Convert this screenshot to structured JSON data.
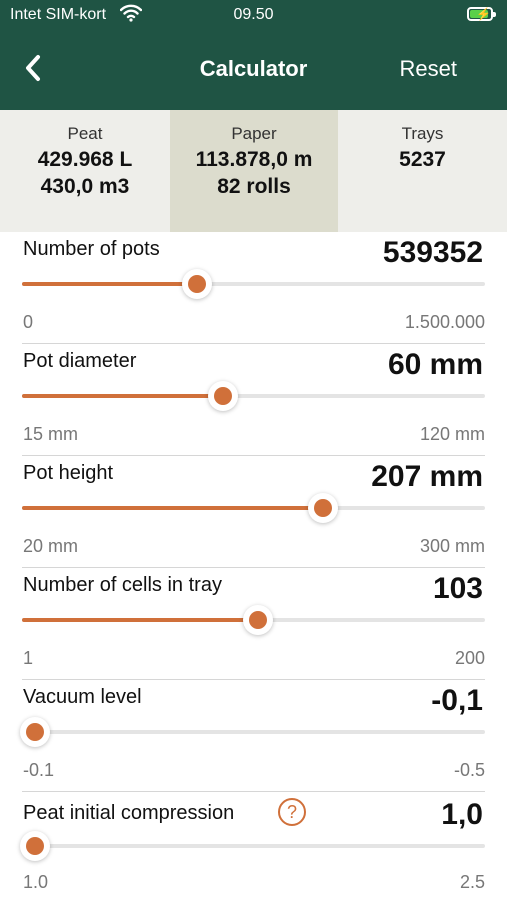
{
  "status_bar": {
    "carrier": "Intet SIM-kort",
    "time": "09.50",
    "wifi_icon": "wifi-icon",
    "battery_icon": "battery-charging-icon"
  },
  "nav": {
    "back_icon": "chevron-left-icon",
    "title": "Calculator",
    "reset_label": "Reset"
  },
  "summary": {
    "peat": {
      "label": "Peat",
      "line1": "429.968 L",
      "line2": "430,0 m3"
    },
    "paper": {
      "label": "Paper",
      "line1": "113.878,0 m",
      "line2": "82 rolls",
      "selected": true
    },
    "trays": {
      "label": "Trays",
      "line1": "5237"
    }
  },
  "sliders": [
    {
      "label": "Number of pots",
      "value": "539352",
      "min": "0",
      "max": "1.500.000",
      "fraction": 0.37
    },
    {
      "label": "Pot diameter",
      "value": "60 mm",
      "min": "15 mm",
      "max": "120 mm",
      "fraction": 0.43
    },
    {
      "label": "Pot height",
      "value": "207 mm",
      "min": "20 mm",
      "max": "300 mm",
      "fraction": 0.66
    },
    {
      "label": "Number of cells in tray",
      "value": "103",
      "min": "1",
      "max": "200",
      "fraction": 0.51
    },
    {
      "label": "Vacuum level",
      "value": "-0,1",
      "min": "-0.1",
      "max": "-0.5",
      "fraction": 0.0
    },
    {
      "label": "Peat initial compression",
      "value": "1,0",
      "min": "1.0",
      "max": "2.5",
      "fraction": 0.0,
      "help_label": "?"
    }
  ],
  "colors": {
    "header_bg": "#1f5444",
    "accent": "#d0703a",
    "summary_bg": "#eeeeea",
    "summary_selected_bg": "#dcdccd"
  }
}
